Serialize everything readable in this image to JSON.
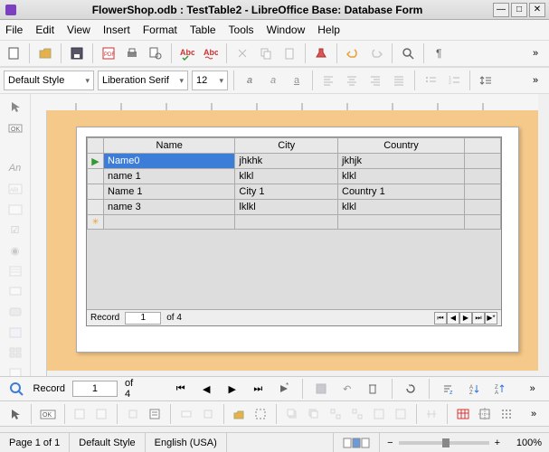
{
  "window": {
    "title": "FlowerShop.odb : TestTable2 - LibreOffice Base: Database Form"
  },
  "menubar": {
    "items": [
      "File",
      "Edit",
      "View",
      "Insert",
      "Format",
      "Table",
      "Tools",
      "Window",
      "Help"
    ]
  },
  "format_toolbar": {
    "style": "Default Style",
    "font": "Liberation Serif",
    "size": "12"
  },
  "table": {
    "columns": [
      "Name",
      "City",
      "Country"
    ],
    "rows": [
      {
        "marker": "▶",
        "cells": [
          "Name0",
          "jhkhk",
          "jkhjk"
        ],
        "selected_col": 0
      },
      {
        "marker": "",
        "cells": [
          "name 1",
          "klkl",
          "klkl"
        ]
      },
      {
        "marker": "",
        "cells": [
          "Name 1",
          "City 1",
          "Country 1"
        ]
      },
      {
        "marker": "",
        "cells": [
          "name 3",
          "lklkl",
          "klkl"
        ]
      },
      {
        "marker": "✳",
        "cells": [
          "",
          "",
          ""
        ]
      }
    ]
  },
  "inner_recordbar": {
    "label": "Record",
    "current": "1",
    "of": "of 4"
  },
  "outer_recordbar": {
    "label": "Record",
    "current": "1",
    "of": "of 4"
  },
  "statusbar": {
    "page": "Page 1 of 1",
    "style": "Default Style",
    "language": "English (USA)",
    "zoom": "100%"
  }
}
